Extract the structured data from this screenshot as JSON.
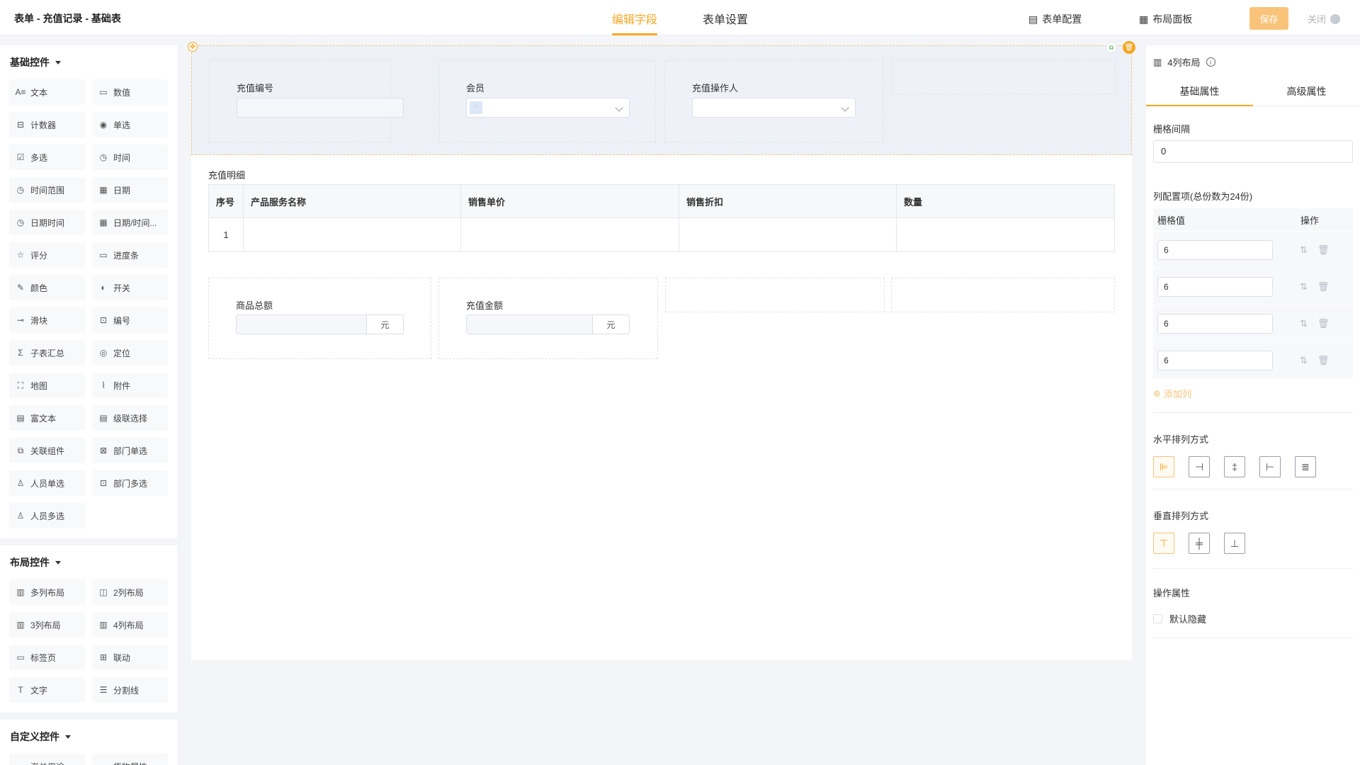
{
  "header": {
    "title": "表单 - 充值记录 - 基础表",
    "tabs": [
      "编辑字段",
      "表单设置"
    ],
    "form_config_label": "表单配置",
    "layout_panel_label": "布局面板",
    "save_label": "保存",
    "close_label": "关闭"
  },
  "left": {
    "basic_title": "基础控件",
    "basic_items": [
      {
        "label": "文本",
        "icon": "text-icon",
        "glyph": "A≡"
      },
      {
        "label": "数值",
        "icon": "number-icon",
        "glyph": "▭"
      },
      {
        "label": "计数器",
        "icon": "counter-icon",
        "glyph": "⊟"
      },
      {
        "label": "单选",
        "icon": "radio-icon",
        "glyph": "◉"
      },
      {
        "label": "多选",
        "icon": "checkbox-icon",
        "glyph": "☑"
      },
      {
        "label": "时间",
        "icon": "clock-icon",
        "glyph": "◷"
      },
      {
        "label": "时间范围",
        "icon": "time-range-icon",
        "glyph": "◷"
      },
      {
        "label": "日期",
        "icon": "calendar-icon",
        "glyph": "▦"
      },
      {
        "label": "日期时间",
        "icon": "datetime-icon",
        "glyph": "◷"
      },
      {
        "label": "日期/时间...",
        "icon": "date-time-range-icon",
        "glyph": "▦"
      },
      {
        "label": "评分",
        "icon": "star-icon",
        "glyph": "☆"
      },
      {
        "label": "进度条",
        "icon": "progress-icon",
        "glyph": "▭"
      },
      {
        "label": "颜色",
        "icon": "color-picker-icon",
        "glyph": "✎"
      },
      {
        "label": "开关",
        "icon": "switch-icon",
        "glyph": "◐"
      },
      {
        "label": "滑块",
        "icon": "slider-icon",
        "glyph": "⊸"
      },
      {
        "label": "编号",
        "icon": "serial-icon",
        "glyph": "⊡"
      },
      {
        "label": "子表汇总",
        "icon": "sigma-icon",
        "glyph": "Σ"
      },
      {
        "label": "定位",
        "icon": "location-icon",
        "glyph": "◎"
      },
      {
        "label": "地图",
        "icon": "map-icon",
        "glyph": "⛶"
      },
      {
        "label": "附件",
        "icon": "paperclip-icon",
        "glyph": "⌇"
      },
      {
        "label": "富文本",
        "icon": "rich-text-icon",
        "glyph": "▤"
      },
      {
        "label": "级联选择",
        "icon": "cascader-icon",
        "glyph": "▤"
      },
      {
        "label": "关联组件",
        "icon": "link-component-icon",
        "glyph": "⧉"
      },
      {
        "label": "部门单选",
        "icon": "department-icon",
        "glyph": "⊠"
      },
      {
        "label": "人员单选",
        "icon": "user-icon",
        "glyph": "♙"
      },
      {
        "label": "部门多选",
        "icon": "department-multi-icon",
        "glyph": "⊡"
      },
      {
        "label": "人员多选",
        "icon": "users-icon",
        "glyph": "♙"
      }
    ],
    "layout_title": "布局控件",
    "layout_items": [
      {
        "label": "多列布局",
        "icon": "multi-column-icon",
        "glyph": "▥"
      },
      {
        "label": "2列布局",
        "icon": "two-column-icon",
        "glyph": "◫"
      },
      {
        "label": "3列布局",
        "icon": "three-column-icon",
        "glyph": "▥"
      },
      {
        "label": "4列布局",
        "icon": "four-column-icon",
        "glyph": "▥"
      },
      {
        "label": "标签页",
        "icon": "tabs-icon",
        "glyph": "▭"
      },
      {
        "label": "联动",
        "icon": "linkage-icon",
        "glyph": "⊞"
      },
      {
        "label": "文字",
        "icon": "text-T-icon",
        "glyph": "T"
      },
      {
        "label": "分割线",
        "icon": "divider-icon",
        "glyph": "☰"
      }
    ],
    "custom_title": "自定义控件",
    "custom_items": [
      {
        "label": "海关用途",
        "icon": "chevron-down-icon",
        "glyph": "⌄"
      },
      {
        "label": "货物属性",
        "icon": "chevron-down-icon",
        "glyph": "⌄"
      }
    ]
  },
  "canvas": {
    "field_recharge_no": "充值编号",
    "field_member": "会员",
    "field_operator": "充值操作人",
    "member_tag": "-",
    "subtable_title": "充值明细",
    "subtable_headers": [
      "序号",
      "产品服务名称",
      "销售单价",
      "销售折扣",
      "数量"
    ],
    "subtable_rows": [
      [
        "1",
        "",
        "",
        "",
        ""
      ]
    ],
    "field_goods_total": "商品总额",
    "field_recharge_amount": "充值金额",
    "unit_yuan": "元"
  },
  "right": {
    "component_name": "4列布局",
    "tabs": [
      "基础属性",
      "高级属性"
    ],
    "gutter_label": "栅格间隔",
    "gutter_value": "0",
    "columns_label": "列配置项(总份数为24份)",
    "col_header_value": "栅格值",
    "col_header_ops": "操作",
    "columns": [
      "6",
      "6",
      "6",
      "6"
    ],
    "add_column": "添加列",
    "h_align_label": "水平排列方式",
    "v_align_label": "垂直排列方式",
    "op_attr_label": "操作属性",
    "default_hidden": "默认隐藏"
  },
  "colors": {
    "accent": "#f5a623",
    "save_button": "#f9c47a"
  }
}
